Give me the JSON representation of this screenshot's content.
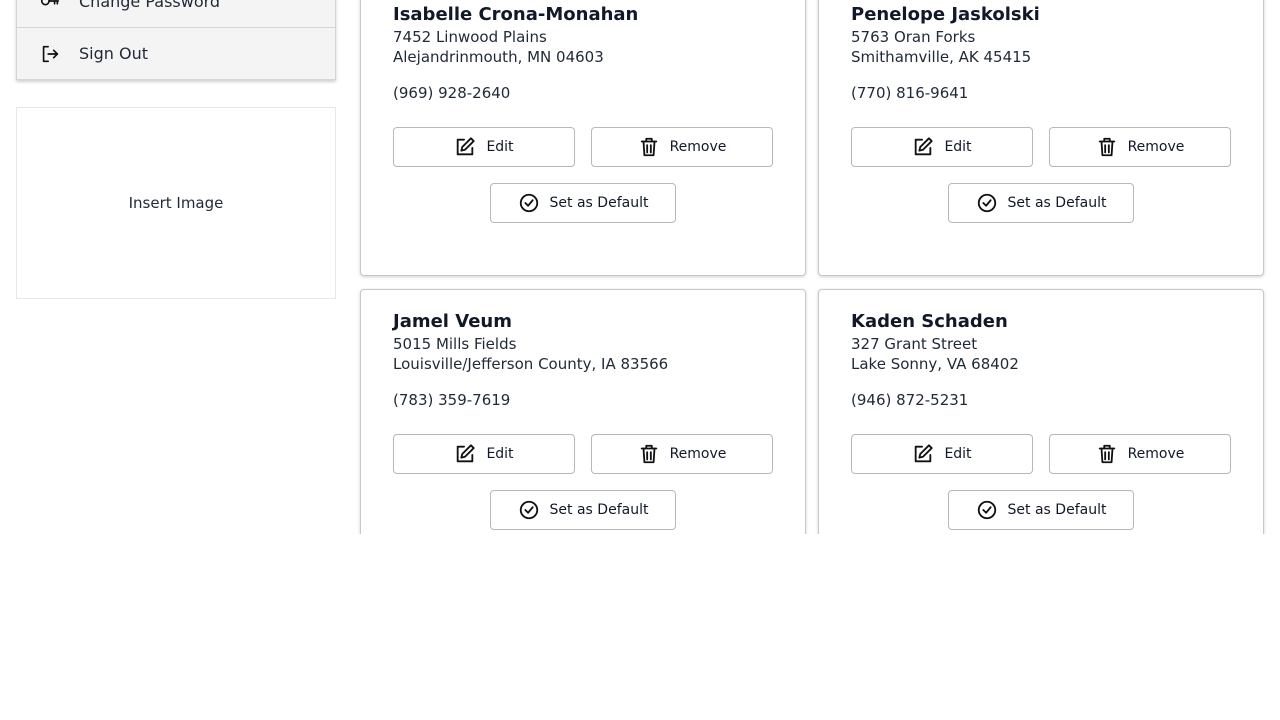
{
  "menu": {
    "items": [
      {
        "label": "Change Password",
        "icon": "key-icon"
      },
      {
        "label": "Sign Out",
        "icon": "sign-out-icon"
      }
    ]
  },
  "insert_image": {
    "label": "Insert Image"
  },
  "buttons": {
    "edit": "Edit",
    "remove": "Remove",
    "set_default": "Set as Default"
  },
  "addresses": [
    {
      "name": "Isabelle Crona-Monahan",
      "street": "7452 Linwood Plains",
      "city": "Alejandrinmouth, MN 04603",
      "phone": "(969) 928-2640"
    },
    {
      "name": "Penelope Jaskolski",
      "street": "5763 Oran Forks",
      "city": "Smithamville, AK 45415",
      "phone": "(770) 816-9641"
    },
    {
      "name": "Jamel Veum",
      "street": "5015 Mills Fields",
      "city": "Louisville/Jefferson County, IA 83566",
      "phone": "(783) 359-7619"
    },
    {
      "name": "Kaden Schaden",
      "street": "327 Grant Street",
      "city": "Lake Sonny, VA 68402",
      "phone": "(946) 872-5231"
    }
  ]
}
